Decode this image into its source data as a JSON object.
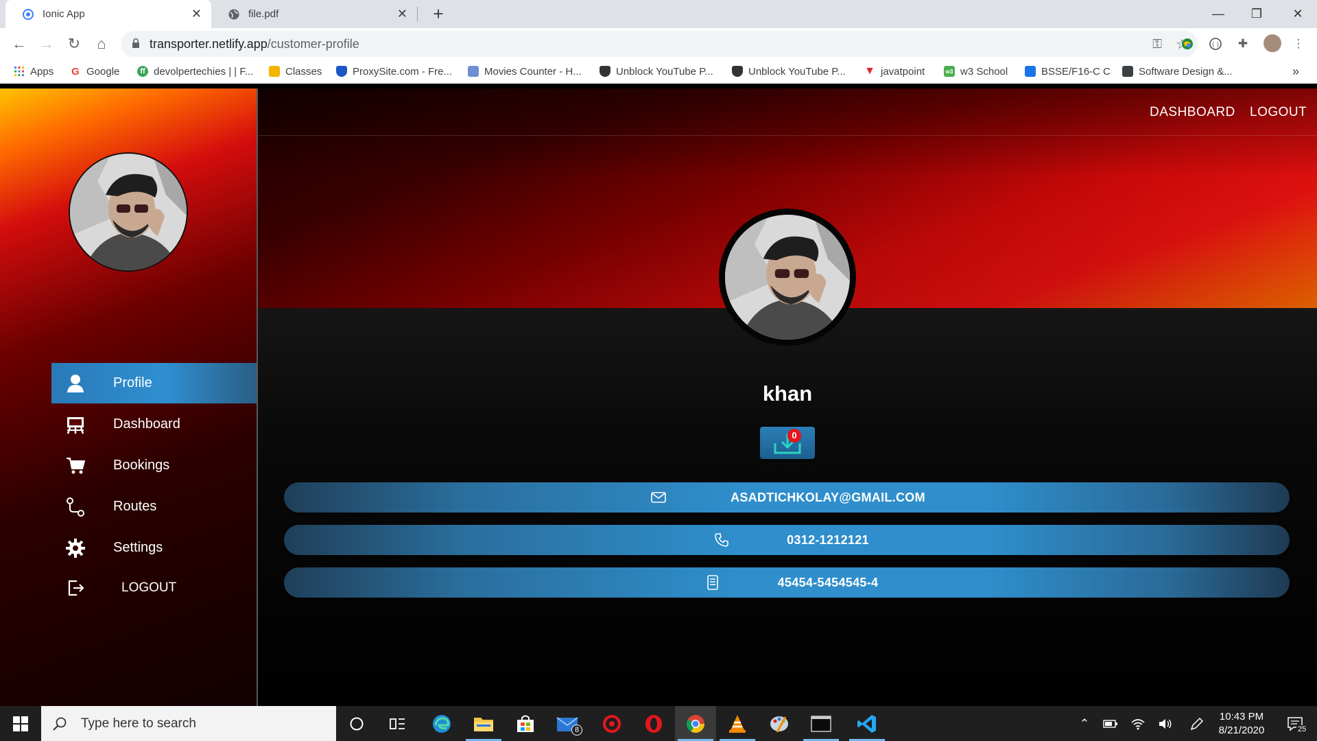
{
  "browser": {
    "tabs": [
      {
        "title": "Ionic App",
        "icon": "ionic-icon",
        "active": true
      },
      {
        "title": "file.pdf",
        "icon": "globe-icon",
        "active": false
      }
    ],
    "url_host": "transporter.netlify.app",
    "url_path": "/customer-profile",
    "bookmarks": [
      {
        "label": "Apps",
        "icon": "apps-grid-icon",
        "color": "#4285f4"
      },
      {
        "label": "Google",
        "icon": "google-icon",
        "color": "#ea4335"
      },
      {
        "label": "devolpertechies | | F...",
        "icon": "green-badge-icon",
        "color": "#3aa757"
      },
      {
        "label": "Classes",
        "icon": "classroom-icon",
        "color": "#f4b400"
      },
      {
        "label": "ProxySite.com - Fre...",
        "icon": "shield-icon",
        "color": "#1a56c5"
      },
      {
        "label": "Movies Counter - H...",
        "icon": "movies-icon",
        "color": "#6d8fd1"
      },
      {
        "label": "Unblock YouTube P...",
        "icon": "shield-dark-icon",
        "color": "#333333"
      },
      {
        "label": "Unblock YouTube P...",
        "icon": "shield-dark-icon",
        "color": "#333333"
      },
      {
        "label": "javatpoint",
        "icon": "javatpoint-icon",
        "color": "#e3242b"
      },
      {
        "label": "w3 School",
        "icon": "w3-icon",
        "color": "#4caf50"
      },
      {
        "label": "BSSE/F16-C C",
        "icon": "person-badge-icon",
        "color": "#1a73e8"
      },
      {
        "label": "Software Design &...",
        "icon": "person-badge-dark-icon",
        "color": "#3c4043"
      }
    ],
    "more_bookmarks": "»"
  },
  "sidebar": {
    "avatar_alt": "profile picture",
    "items": [
      {
        "label": "Profile",
        "icon": "person-icon",
        "active": true
      },
      {
        "label": "Dashboard",
        "icon": "easel-icon",
        "active": false
      },
      {
        "label": "Bookings",
        "icon": "cart-icon",
        "active": false
      },
      {
        "label": "Routes",
        "icon": "route-icon",
        "active": false
      },
      {
        "label": "Settings",
        "icon": "gear-icon",
        "active": false
      },
      {
        "label": "LOGOUT",
        "icon": "logout-icon",
        "active": false
      }
    ]
  },
  "header": {
    "dashboard_label": "DASHBOARD",
    "logout_label": "LOGOUT"
  },
  "profile": {
    "username": "khan",
    "download_badge": "0",
    "email": "ASADTICHKOLAY@GMAIL.COM",
    "phone": "0312-1212121",
    "cnic": "45454-5454545-4"
  },
  "taskbar": {
    "search_placeholder": "Type here to search",
    "mail_badge": "8",
    "time": "10:43 PM",
    "date": "8/21/2020",
    "notifications": "25"
  },
  "colors": {
    "accent_blue": "#2f8ecb",
    "sidebar_red": "#d40d0d",
    "badge_red": "#e4161b"
  }
}
